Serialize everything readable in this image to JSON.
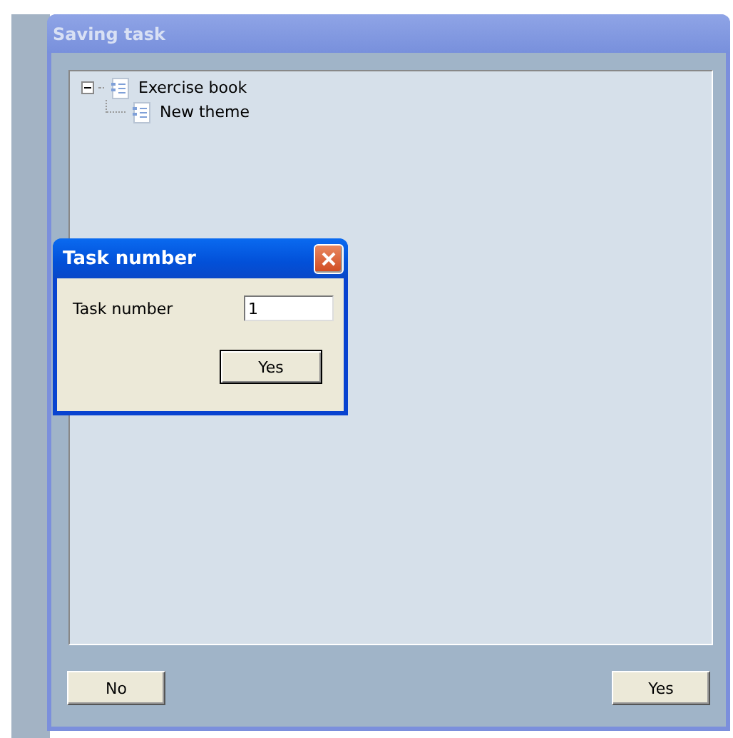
{
  "window": {
    "title": "Saving task",
    "active": false
  },
  "tree": [
    {
      "label": "Exercise book",
      "expanded": true,
      "children": [
        {
          "label": "New theme"
        }
      ]
    }
  ],
  "buttons": [
    {
      "label": "No"
    },
    {
      "label": "Yes"
    }
  ],
  "dialog": {
    "title": "Task number",
    "active": true,
    "field_label": "Task number",
    "value": "1",
    "button": "Yes"
  }
}
